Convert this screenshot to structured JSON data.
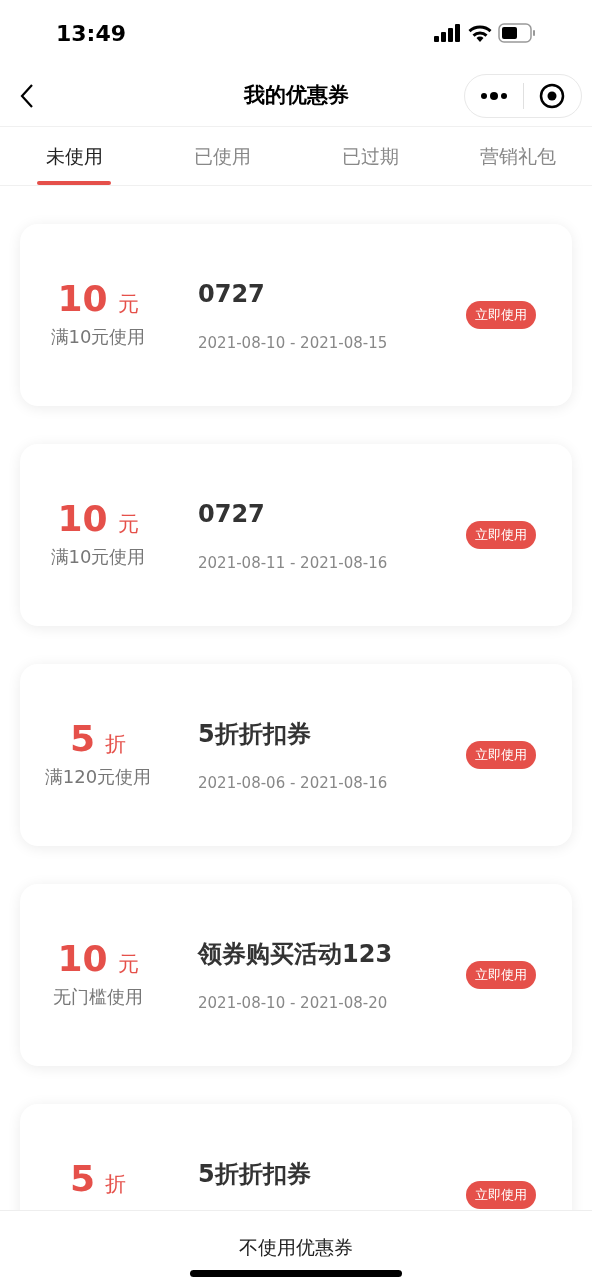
{
  "status_bar": {
    "time": "13:49"
  },
  "nav": {
    "title": "我的优惠券"
  },
  "tabs": [
    {
      "label": "未使用",
      "selected": true
    },
    {
      "label": "已使用",
      "selected": false
    },
    {
      "label": "已过期",
      "selected": false
    },
    {
      "label": "营销礼包",
      "selected": false
    }
  ],
  "coupons": [
    {
      "value": "10",
      "unit": "元",
      "condition": "满10元使用",
      "title": "0727",
      "dates": "2021-08-10 - 2021-08-15",
      "action": "立即使用"
    },
    {
      "value": "10",
      "unit": "元",
      "condition": "满10元使用",
      "title": "0727",
      "dates": "2021-08-11 - 2021-08-16",
      "action": "立即使用"
    },
    {
      "value": "5",
      "unit": "折",
      "condition": "满120元使用",
      "title": "5折折扣券",
      "dates": "2021-08-06 - 2021-08-16",
      "action": "立即使用"
    },
    {
      "value": "10",
      "unit": "元",
      "condition": "无门槛使用",
      "title": "领券购买活动123",
      "dates": "2021-08-10 - 2021-08-20",
      "action": "立即使用"
    },
    {
      "value": "5",
      "unit": "折",
      "title": "5折折扣券",
      "action": "立即使用"
    }
  ],
  "footer": {
    "label": "不使用优惠券"
  }
}
